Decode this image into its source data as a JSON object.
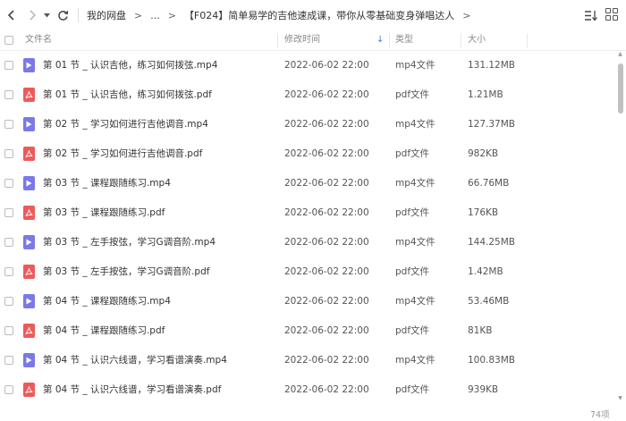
{
  "nav": {
    "back_icon": "chevron-left-icon",
    "forward_icon": "chevron-right-icon",
    "history_icon": "caret-down-icon",
    "refresh_icon": "refresh-icon"
  },
  "breadcrumb": {
    "items": [
      "我的网盘",
      "...",
      "【F024】简单易学的吉他速成课，带你从零基础变身弹唱达人"
    ],
    "separator": ">"
  },
  "toolbar": {
    "sort_icon": "sort-list-icon",
    "view_icon": "grid-view-icon"
  },
  "table": {
    "columns": {
      "name": "文件名",
      "modified": "修改时间",
      "type": "类型",
      "size": "大小"
    },
    "sort_indicator": "↓",
    "rows": [
      {
        "kind": "mp4",
        "name": "第 01 节 _ 认识吉他，练习如何拨弦.mp4",
        "modified": "2022-06-02 22:00",
        "type": "mp4文件",
        "size": "131.12MB"
      },
      {
        "kind": "pdf",
        "name": "第 01 节 _ 认识吉他，练习如何拨弦.pdf",
        "modified": "2022-06-02 22:00",
        "type": "pdf文件",
        "size": "1.21MB"
      },
      {
        "kind": "mp4",
        "name": "第 02 节 _ 学习如何进行吉他调音.mp4",
        "modified": "2022-06-02 22:00",
        "type": "mp4文件",
        "size": "127.37MB"
      },
      {
        "kind": "pdf",
        "name": "第 02 节 _ 学习如何进行吉他调音.pdf",
        "modified": "2022-06-02 22:00",
        "type": "pdf文件",
        "size": "982KB"
      },
      {
        "kind": "mp4",
        "name": "第 03 节 _ 课程跟随练习.mp4",
        "modified": "2022-06-02 22:00",
        "type": "mp4文件",
        "size": "66.76MB"
      },
      {
        "kind": "pdf",
        "name": "第 03 节 _ 课程跟随练习.pdf",
        "modified": "2022-06-02 22:00",
        "type": "pdf文件",
        "size": "176KB"
      },
      {
        "kind": "mp4",
        "name": "第 03 节 _ 左手按弦，学习G调音阶.mp4",
        "modified": "2022-06-02 22:00",
        "type": "mp4文件",
        "size": "144.25MB"
      },
      {
        "kind": "pdf",
        "name": "第 03 节 _ 左手按弦，学习G调音阶.pdf",
        "modified": "2022-06-02 22:00",
        "type": "pdf文件",
        "size": "1.42MB"
      },
      {
        "kind": "mp4",
        "name": "第 04 节 _ 课程跟随练习.mp4",
        "modified": "2022-06-02 22:00",
        "type": "mp4文件",
        "size": "53.46MB"
      },
      {
        "kind": "pdf",
        "name": "第 04 节 _ 课程跟随练习.pdf",
        "modified": "2022-06-02 22:00",
        "type": "pdf文件",
        "size": "81KB"
      },
      {
        "kind": "mp4",
        "name": "第 04 节 _ 认识六线谱，学习看谱演奏.mp4",
        "modified": "2022-06-02 22:00",
        "type": "mp4文件",
        "size": "100.83MB"
      },
      {
        "kind": "pdf",
        "name": "第 04 节 _ 认识六线谱，学习看谱演奏.pdf",
        "modified": "2022-06-02 22:00",
        "type": "pdf文件",
        "size": "939KB"
      }
    ]
  },
  "colors": {
    "mp4_icon": "#7b79e6",
    "pdf_icon": "#ee5a5a",
    "accent": "#3a7bf5"
  },
  "footer": {
    "count": "74项"
  }
}
